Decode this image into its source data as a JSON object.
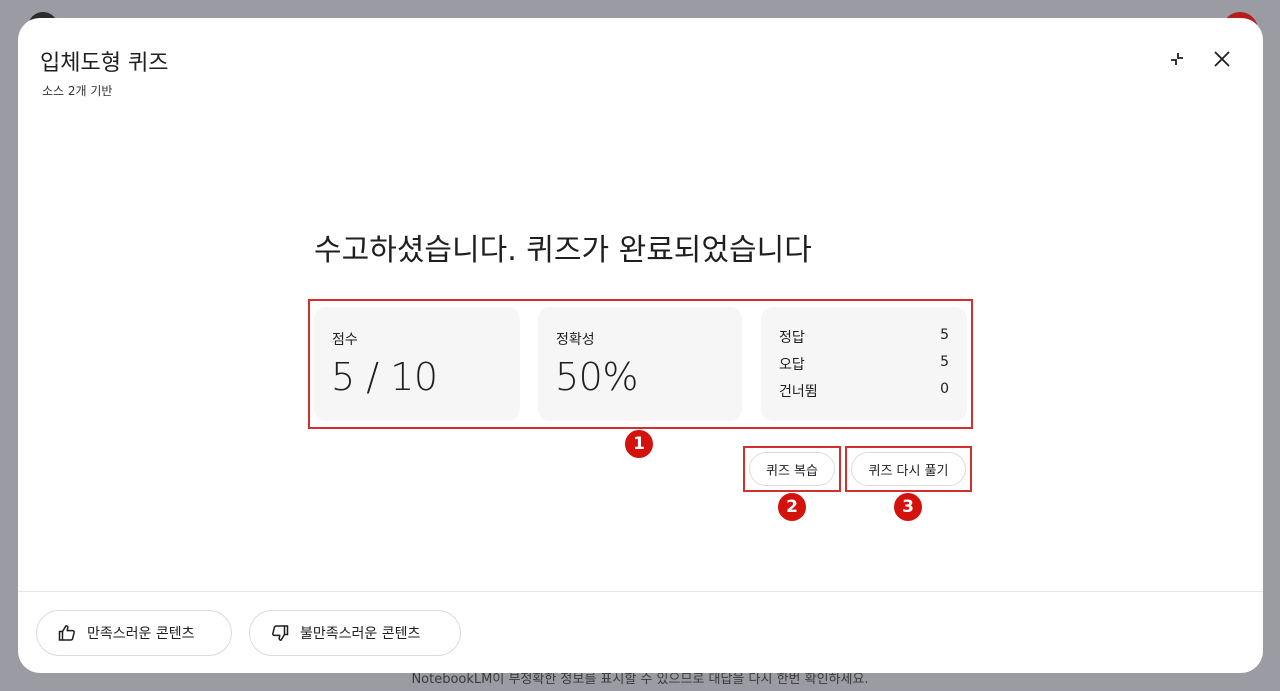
{
  "dialog": {
    "title": "입체도형 퀴즈",
    "subtitle": "소스 2개 기반",
    "collapse_icon": "collapse-icon",
    "close_icon": "close-icon"
  },
  "result": {
    "headline": "수고하셨습니다. 퀴즈가 완료되었습니다",
    "score": {
      "label": "점수",
      "value": "5 / 10"
    },
    "accuracy": {
      "label": "정확성",
      "value": "50%"
    },
    "details": [
      {
        "label": "정답",
        "value": "5"
      },
      {
        "label": "오답",
        "value": "5"
      },
      {
        "label": "건너뜀",
        "value": "0"
      }
    ]
  },
  "actions": {
    "review_label": "퀴즈 복습",
    "retake_label": "퀴즈 다시 풀기"
  },
  "annotations": {
    "badge1": "1",
    "badge2": "2",
    "badge3": "3"
  },
  "feedback": {
    "positive_label": "만족스러운 콘텐츠",
    "negative_label": "불만족스러운 콘텐츠"
  },
  "footer": {
    "disclaimer": "NotebookLM이 부정확한 정보를 표시할 수 있으므로 대답을 다시 한번 확인하세요."
  },
  "colors": {
    "highlight": "#d32f2f",
    "badge": "#d4120d",
    "card_bg": "#f6f6f6"
  }
}
